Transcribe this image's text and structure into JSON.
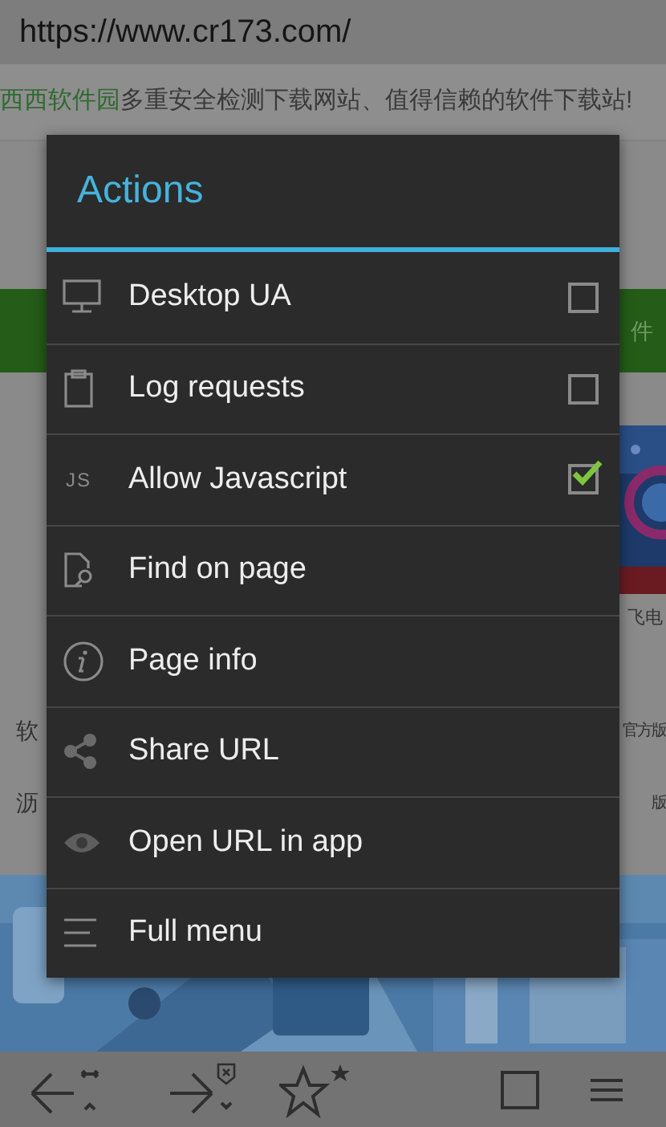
{
  "address_bar": {
    "url": "https://www.cr173.com/"
  },
  "page": {
    "site_name": "西西软件园",
    "tagline": "多重安全检测下载网站、值得信赖的软件下载站!",
    "green_bar_text": "件",
    "card_caption": "飞电",
    "rows": [
      {
        "left": "软",
        "right": "官方版"
      },
      {
        "left": "沥",
        "right": "版"
      }
    ]
  },
  "dialog": {
    "title": "Actions",
    "items": [
      {
        "label": "Desktop UA",
        "kind": "checkbox",
        "checked": false
      },
      {
        "label": "Log requests",
        "kind": "checkbox",
        "checked": false
      },
      {
        "label": "Allow Javascript",
        "kind": "checkbox",
        "checked": true,
        "icon_text": "JS"
      },
      {
        "label": "Find on page",
        "kind": "action"
      },
      {
        "label": "Page info",
        "kind": "action"
      },
      {
        "label": "Share URL",
        "kind": "action"
      },
      {
        "label": "Open URL in app",
        "kind": "action"
      },
      {
        "label": "Full menu",
        "kind": "action"
      }
    ]
  }
}
